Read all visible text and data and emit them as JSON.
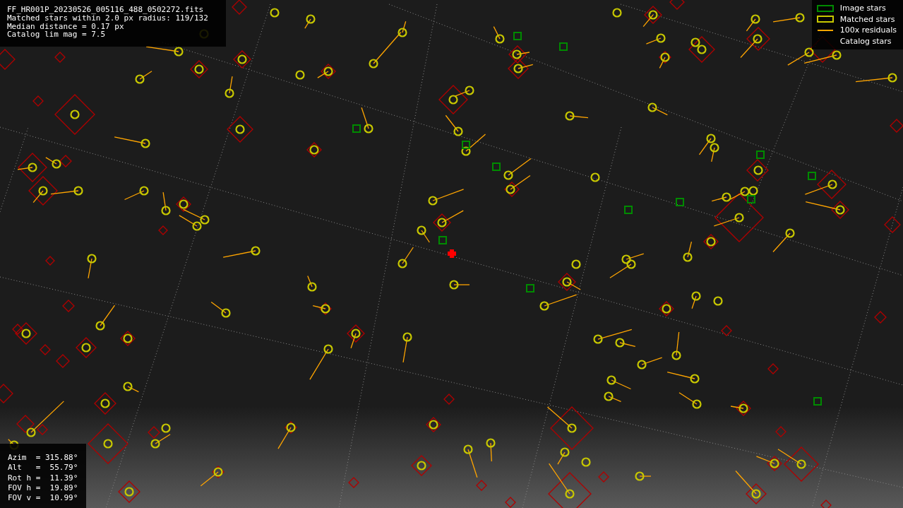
{
  "image_info": {
    "lines": [
      "FF_HR001P_20230526_005116_488_0502272.fits",
      "Matched stars within 2.0 px radius: 119/132",
      "Median distance = 0.17 px",
      "Catalog lim mag = 7.5"
    ]
  },
  "legend": {
    "items": [
      {
        "kind": "image",
        "label": "Image stars",
        "color": "#008a00"
      },
      {
        "kind": "matched",
        "label": "Matched stars",
        "color": "#c8c800"
      },
      {
        "kind": "residual",
        "label": "100x residuals",
        "color": "#ffa500"
      },
      {
        "kind": "catalog",
        "label": "Catalog stars"
      }
    ]
  },
  "pointing_info": {
    "lines": [
      "Azim  = 315.88°",
      "Alt   =  55.79°",
      "Rot h =  11.39°",
      "FOV h =  19.89°",
      "FOV v =  10.99°"
    ]
  }
}
